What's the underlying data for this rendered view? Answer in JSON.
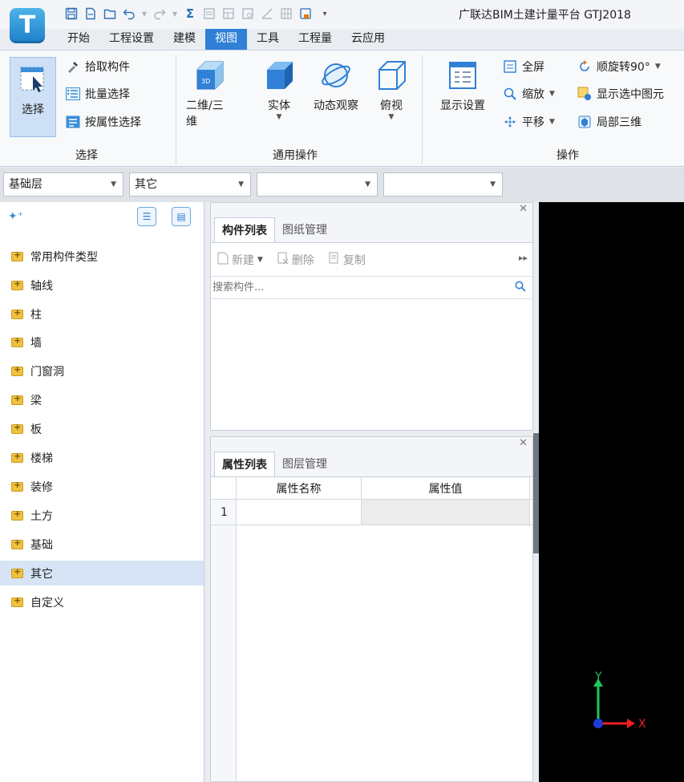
{
  "app": {
    "logo_letter": "T",
    "title": "广联达BIM土建计量平台 GTJ2018"
  },
  "quick_access": [
    "save-icon",
    "new-icon",
    "open-icon",
    "undo-icon",
    "redo-icon",
    "sum-icon",
    "report-icon",
    "table-icon",
    "table2-icon",
    "line-icon",
    "grid-icon",
    "export-icon",
    "customize-icon"
  ],
  "tabs": [
    "开始",
    "工程设置",
    "建模",
    "视图",
    "工具",
    "工程量",
    "云应用"
  ],
  "active_tab": "视图",
  "ribbon": {
    "select_group": {
      "label": "选择",
      "select_button": "选择",
      "pick_component": "拾取构件",
      "batch_select": "批量选择",
      "select_by_attr": "按属性选择"
    },
    "general_group": {
      "label": "通用操作",
      "view_2d3d": "二维/三维",
      "solid": "实体",
      "dynamic_view": "动态观察",
      "top_view": "俯视",
      "cube_label": "3D"
    },
    "operate_group": {
      "label": "操作",
      "display_settings": "显示设置",
      "fullscreen": "全屏",
      "zoom": "缩放",
      "pan": "平移",
      "rotate": "顺旋转90°",
      "show_selected": "显示选中图元",
      "local_3d": "局部三维"
    }
  },
  "filters": {
    "floor": "基础层",
    "category": "其它",
    "type": "",
    "component": ""
  },
  "tree": {
    "items": [
      "常用构件类型",
      "轴线",
      "柱",
      "墙",
      "门窗洞",
      "梁",
      "板",
      "楼梯",
      "装修",
      "土方",
      "基础",
      "其它",
      "自定义"
    ],
    "selected": "其它"
  },
  "component_panel": {
    "tabs": [
      "构件列表",
      "图纸管理"
    ],
    "toolbar": {
      "new": "新建",
      "delete": "删除",
      "copy": "复制"
    },
    "search_placeholder": "搜索构件..."
  },
  "property_panel": {
    "tabs": [
      "属性列表",
      "图层管理"
    ],
    "columns": [
      "属性名称",
      "属性值"
    ],
    "rows": [
      {
        "index": "1",
        "name": "",
        "value": ""
      }
    ]
  },
  "viewport": {
    "axis_y": "Y",
    "axis_x": "X"
  },
  "colors": {
    "accent": "#2f80d6",
    "folder": "#f0c040",
    "selected_row": "#d6e4f5",
    "axis_y": "#22c55e",
    "axis_x": "#ef2020",
    "axis_origin": "#1e3ad8"
  }
}
